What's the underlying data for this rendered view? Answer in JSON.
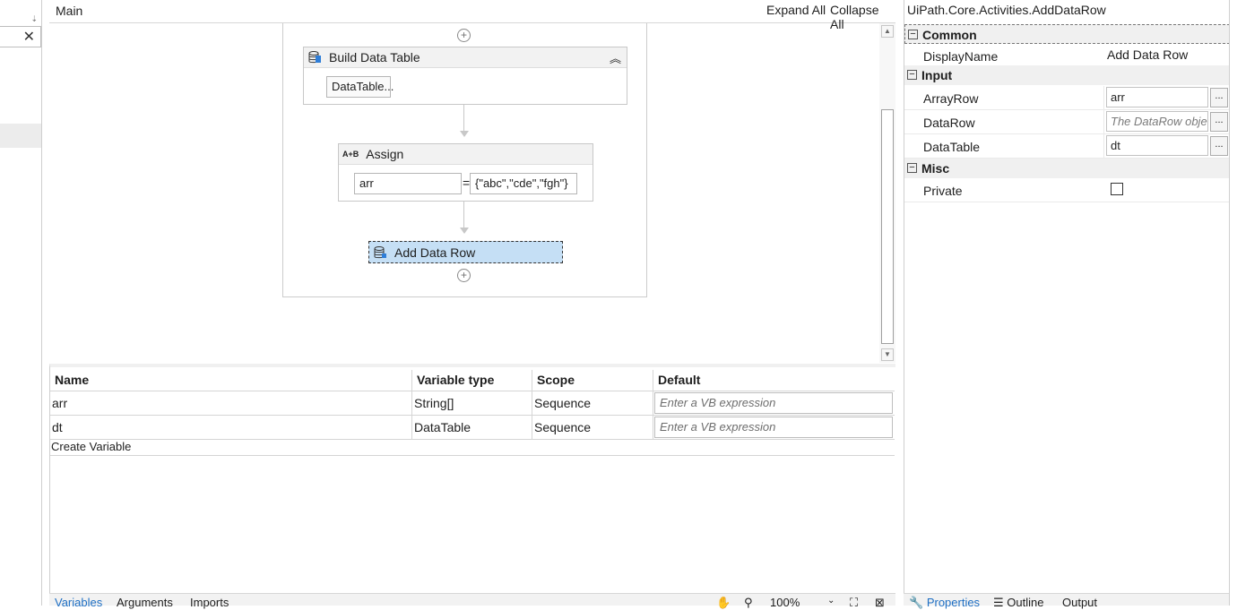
{
  "left_panel": {
    "close_glyph": "✕",
    "grip_glyph": "⇣"
  },
  "designer": {
    "breadcrumb": "Main",
    "expand_all": "Expand All",
    "collapse_all": "Collapse All",
    "activities": {
      "build_data_table": {
        "title": "Build Data Table",
        "button": "DataTable..."
      },
      "assign": {
        "title": "Assign",
        "icon_text": "A+B",
        "left": "arr",
        "equals": "=",
        "right": "{\"abc\",\"cde\",\"fgh\"}"
      },
      "add_data_row": {
        "title": "Add Data Row"
      }
    },
    "plus_glyph": "+",
    "collapse_glyph": "︽"
  },
  "variables": {
    "headers": [
      "Name",
      "Variable type",
      "Scope",
      "Default"
    ],
    "rows": [
      {
        "name": "arr",
        "type": "String[]",
        "scope": "Sequence",
        "default_placeholder": "Enter a VB expression"
      },
      {
        "name": "dt",
        "type": "DataTable",
        "scope": "Sequence",
        "default_placeholder": "Enter a VB expression"
      }
    ],
    "create_variable": "Create Variable"
  },
  "status_bar": {
    "tabs": [
      "Variables",
      "Arguments",
      "Imports"
    ],
    "zoom": "100%"
  },
  "properties": {
    "title": "UiPath.Core.Activities.AddDataRow",
    "categories": {
      "common": "Common",
      "input": "Input",
      "misc": "Misc"
    },
    "display_name": {
      "label": "DisplayName",
      "value": "Add Data Row"
    },
    "array_row": {
      "label": "ArrayRow",
      "value": "arr"
    },
    "data_row": {
      "label": "DataRow",
      "placeholder": "The DataRow obje"
    },
    "data_table": {
      "label": "DataTable",
      "value": "dt"
    },
    "private": {
      "label": "Private",
      "checked": false
    },
    "ellipsis": "...",
    "bottom_tabs": [
      "Properties",
      "Outline",
      "Output"
    ]
  },
  "colors": {
    "selected_activity": "#c5dff5",
    "accent_tab": "#1e6fc4"
  }
}
